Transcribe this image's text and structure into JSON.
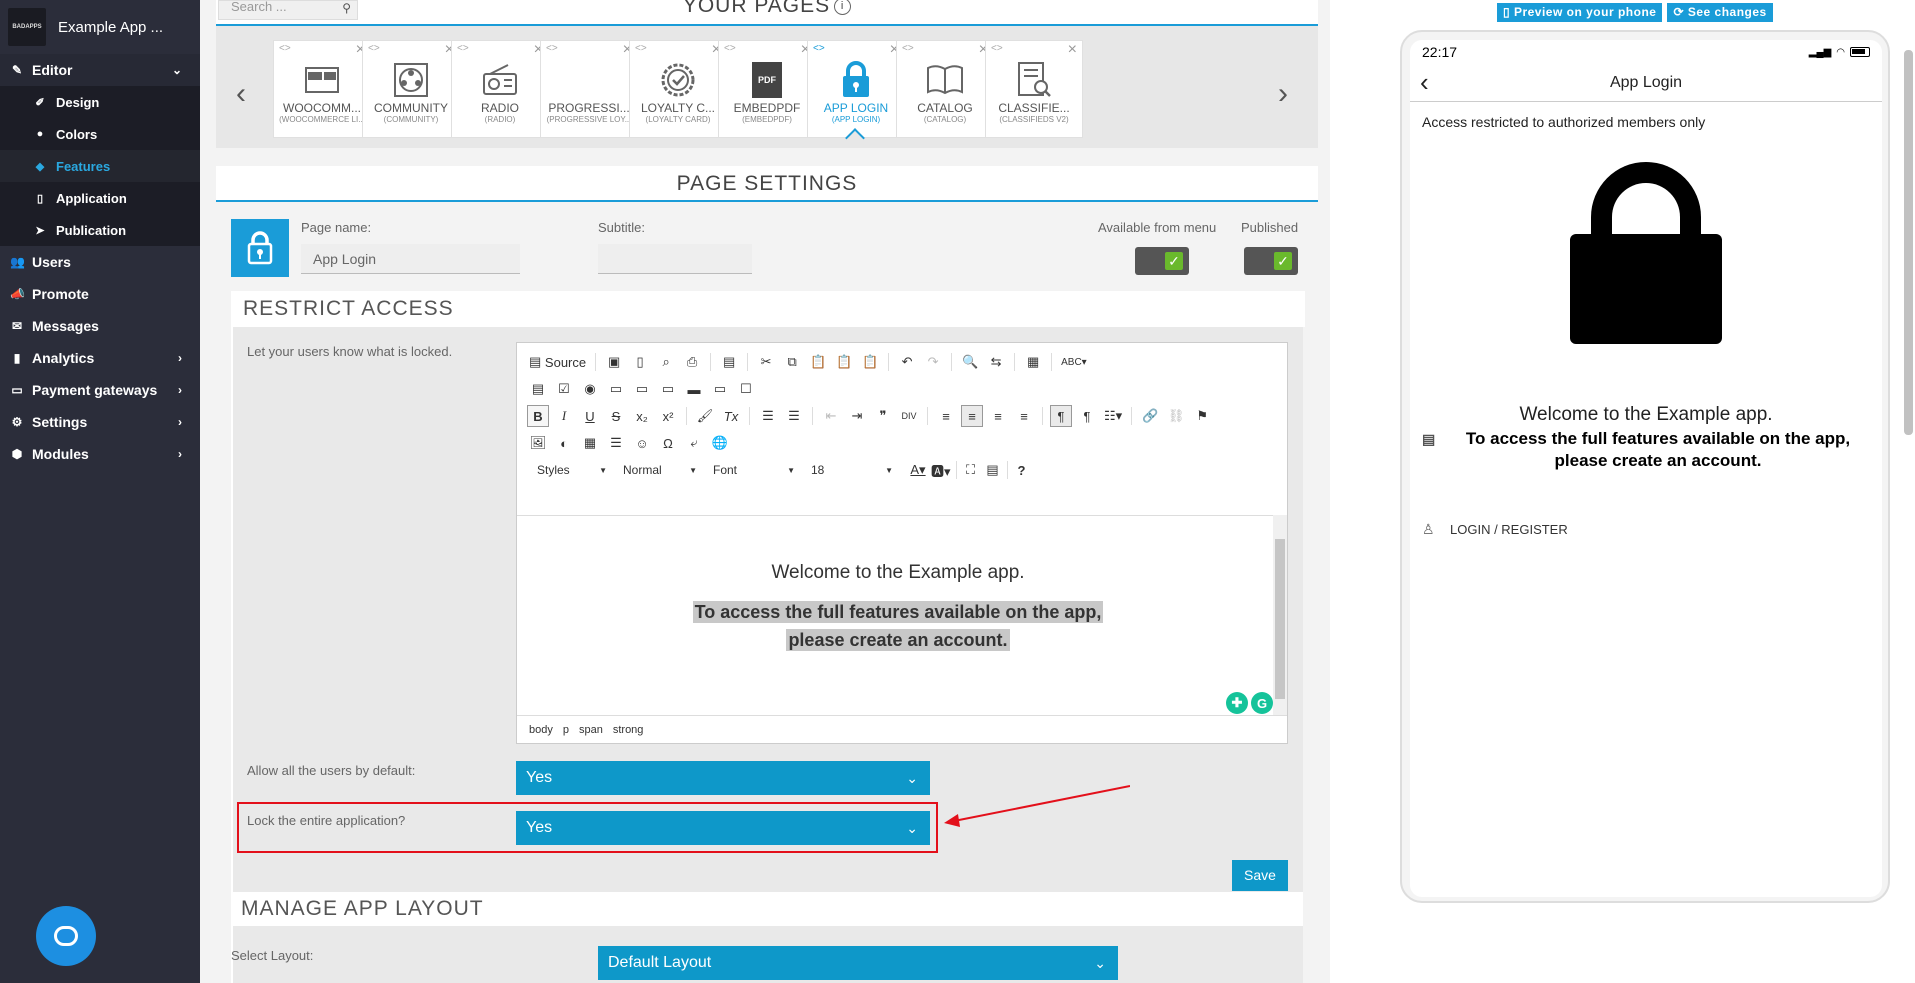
{
  "brand": {
    "name": "Example App ...",
    "logo_text": "BADAPPS"
  },
  "sidebar": {
    "editor": {
      "label": "Editor",
      "icon": "pencil-icon"
    },
    "sub_items": [
      {
        "label": "Design",
        "icon": "ruler-icon"
      },
      {
        "label": "Colors",
        "icon": "palette-icon"
      },
      {
        "label": "Features",
        "icon": "cube-icon",
        "active": true
      },
      {
        "label": "Application",
        "icon": "phone-icon"
      },
      {
        "label": "Publication",
        "icon": "paper-plane-icon"
      }
    ],
    "items": [
      {
        "label": "Users",
        "icon": "users-icon"
      },
      {
        "label": "Promote",
        "icon": "megaphone-icon"
      },
      {
        "label": "Messages",
        "icon": "envelope-icon"
      },
      {
        "label": "Analytics",
        "icon": "bar-chart-icon"
      },
      {
        "label": "Payment gateways",
        "icon": "credit-card-icon"
      },
      {
        "label": "Settings",
        "icon": "wrench-icon"
      },
      {
        "label": "Modules",
        "icon": "cubes-icon"
      }
    ]
  },
  "pages": {
    "search_placeholder": "Search ...",
    "title": "YOUR PAGES",
    "tiles": [
      {
        "name": "WOOCOMM...",
        "sub": "(WOOCOMMERCE LI...",
        "icon": "woocommerce-icon"
      },
      {
        "name": "COMMUNITY",
        "sub": "(COMMUNITY)",
        "icon": "community-icon"
      },
      {
        "name": "RADIO",
        "sub": "(RADIO)",
        "icon": "radio-icon"
      },
      {
        "name": "PROGRESSI...",
        "sub": "(PROGRESSIVE LOY...",
        "icon": "progressive-icon"
      },
      {
        "name": "LOYALTY C...",
        "sub": "(LOYALTY CARD)",
        "icon": "loyalty-icon"
      },
      {
        "name": "EMBEDPDF",
        "sub": "(EMBEDPDF)",
        "icon": "pdf-icon",
        "icon_text": "PDF"
      },
      {
        "name": "APP LOGIN",
        "sub": "(APP LOGIN)",
        "icon": "lock-icon",
        "active": true
      },
      {
        "name": "CATALOG",
        "sub": "(CATALOG)",
        "icon": "book-icon"
      },
      {
        "name": "CLASSIFIE...",
        "sub": "(CLASSIFIEDS V2)",
        "icon": "classifieds-icon"
      }
    ]
  },
  "page_settings": {
    "title": "PAGE SETTINGS",
    "page_name_label": "Page name:",
    "page_name_value": "App Login",
    "subtitle_label": "Subtitle:",
    "subtitle_value": "",
    "available_label": "Available from menu",
    "published_label": "Published"
  },
  "restrict": {
    "title": "RESTRICT ACCESS",
    "locked_label": "Let your users know what is locked.",
    "editor": {
      "source_label": "Source",
      "styles": "Styles",
      "format": "Normal",
      "font": "Font",
      "size": "18",
      "welcome": "Welcome to the Example app.",
      "access_line1": "To access the full features available on the app,",
      "access_line2": "please create an account.",
      "status_path": [
        "body",
        "p",
        "span",
        "strong"
      ]
    },
    "allow_label": "Allow all the users by default:",
    "allow_value": "Yes",
    "lock_label": "Lock the entire application?",
    "lock_value": "Yes",
    "save_label": "Save"
  },
  "layout": {
    "title": "MANAGE APP LAYOUT",
    "select_label": "Select Layout:",
    "select_value": "Default Layout"
  },
  "preview": {
    "preview_btn": "Preview on your phone",
    "changes_btn": "See changes",
    "time": "22:17",
    "app_title": "App Login",
    "restrict_text": "Access restricted to authorized members only",
    "welcome": "Welcome to the Example app.",
    "access_text": "To access the full features available on the app, please create an account.",
    "login_label": "LOGIN / REGISTER"
  },
  "colors": {
    "accent": "#1a9cd8",
    "sidebar": "#2b2d3a",
    "select": "#0e98c9",
    "highlight": "#e3101b"
  }
}
